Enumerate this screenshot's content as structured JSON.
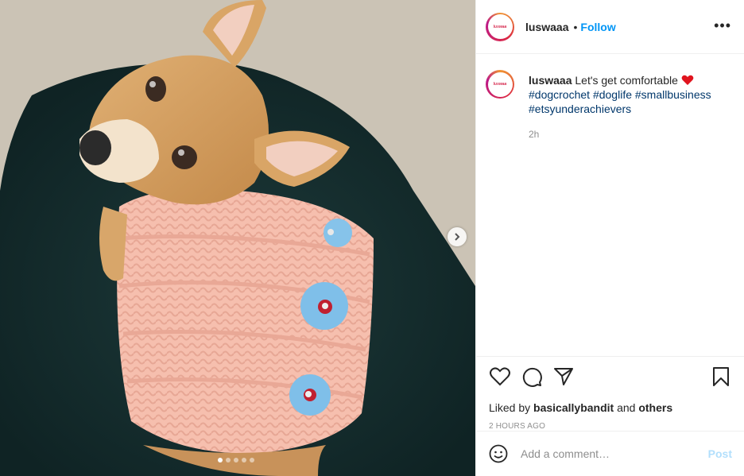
{
  "post": {
    "username": "luswaaa",
    "separator": "•",
    "follow_label": "Follow",
    "more_label": "•••",
    "avatar_text": "luswaa"
  },
  "caption": {
    "username": "luswaaa",
    "text": "Let's get comfortable",
    "emoji": "❤️",
    "hashtags": [
      "#dogcrochet",
      "#doglife",
      "#smallbusiness",
      "#etsyunderachievers"
    ],
    "time": "2h"
  },
  "media": {
    "dot_count": 5,
    "active_dot": 0,
    "next_icon": "chevron-right-icon"
  },
  "actions": {
    "like_icon": "heart-icon",
    "comment_icon": "comment-icon",
    "share_icon": "paper-plane-icon",
    "save_icon": "bookmark-icon"
  },
  "likes": {
    "prefix": "Liked by",
    "user": "basicallybandit",
    "joiner": "and",
    "suffix": "others"
  },
  "timestamp": "2 HOURS AGO",
  "comment_box": {
    "emoji_icon": "smiley-icon",
    "placeholder": "Add a comment…",
    "post_label": "Post"
  },
  "colors": {
    "follow_blue": "#0095f6",
    "hashtag_blue": "#00376b",
    "post_disabled": "#b2dffc",
    "sweater_pink": "#f4b8a8",
    "button_blue": "#7fc0ea"
  }
}
